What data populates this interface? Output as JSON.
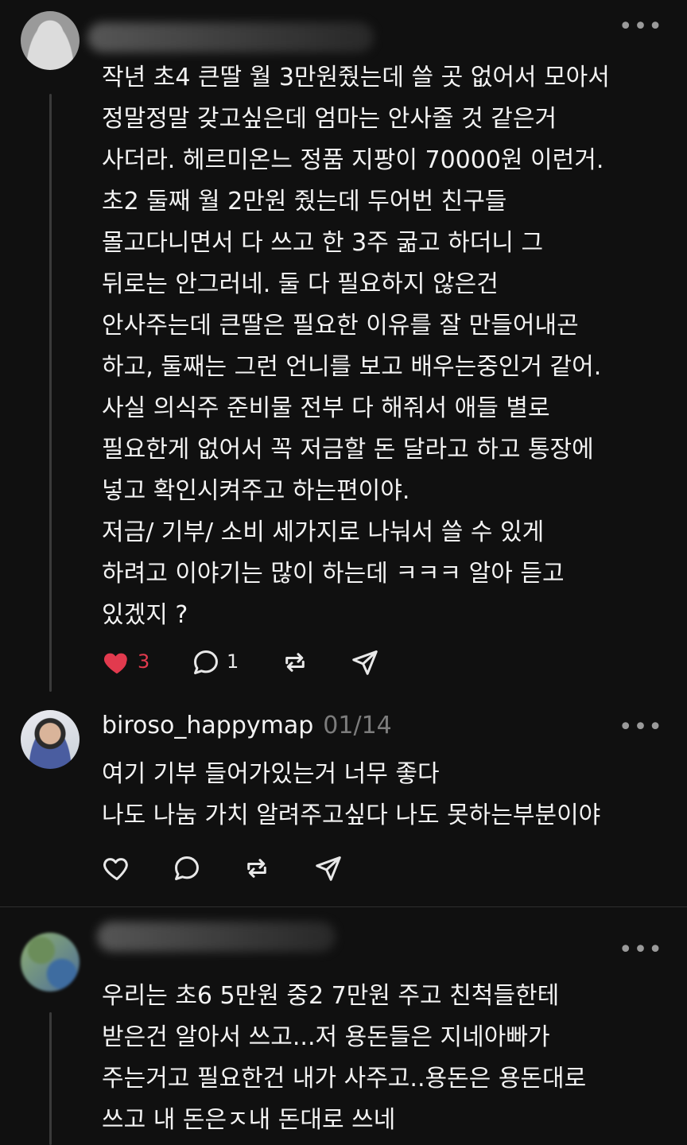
{
  "post1": {
    "lines": [
      "작년 초4 큰딸 월 3만원줬는데 쓸 곳 없어서 모아서",
      "정말정말 갖고싶은데 엄마는 안사줄 것 같은거",
      "사더라. 헤르미온느 정품 지팡이 70000원 이런거.",
      "초2 둘째 월 2만원 줬는데 두어번 친구들",
      "몰고다니면서 다 쓰고 한 3주 굶고 하더니 그",
      "뒤로는 안그러네. 둘 다 필요하지 않은건",
      "안사주는데 큰딸은 필요한 이유를 잘 만들어내곤",
      "하고, 둘째는 그런 언니를 보고 배우는중인거 같어.",
      "사실 의식주 준비물 전부 다 해줘서 애들 별로",
      "필요한게 없어서 꼭 저금할 돈 달라고 하고 통장에",
      "넣고 확인시켜주고 하는편이야.",
      "저금/ 기부/ 소비 세가지로 나눠서 쓸 수 있게",
      "하려고 이야기는 많이 하는데 ㅋㅋㅋ 알아 듣고",
      "있겠지 ?"
    ],
    "likes": "3",
    "replies": "1"
  },
  "post2": {
    "username": "biroso_happymap",
    "date": "01/14",
    "lines": [
      "여기 기부 들어가있는거 너무 좋다",
      "나도 나눔 가치 알려주고싶다 나도 못하는부분이야"
    ]
  },
  "post3": {
    "lines": [
      "우리는 초6  5만원  중2 7만원 주고 친척들한테",
      "받은건 알아서 쓰고...저 용돈들은 지네아빠가",
      "주는거고 필요한건 내가 사주고..용돈은 용돈대로",
      "쓰고 내 돈은ㅈ내 돈대로 쓰네"
    ]
  },
  "icons": {
    "more": "more-horizontal-icon",
    "like": "heart-icon",
    "reply": "comment-icon",
    "repost": "repost-icon",
    "share": "send-icon"
  },
  "colors": {
    "background": "#101010",
    "text": "#f3f3f3",
    "muted": "#7c7c7c",
    "liked": "#e23a4e"
  }
}
